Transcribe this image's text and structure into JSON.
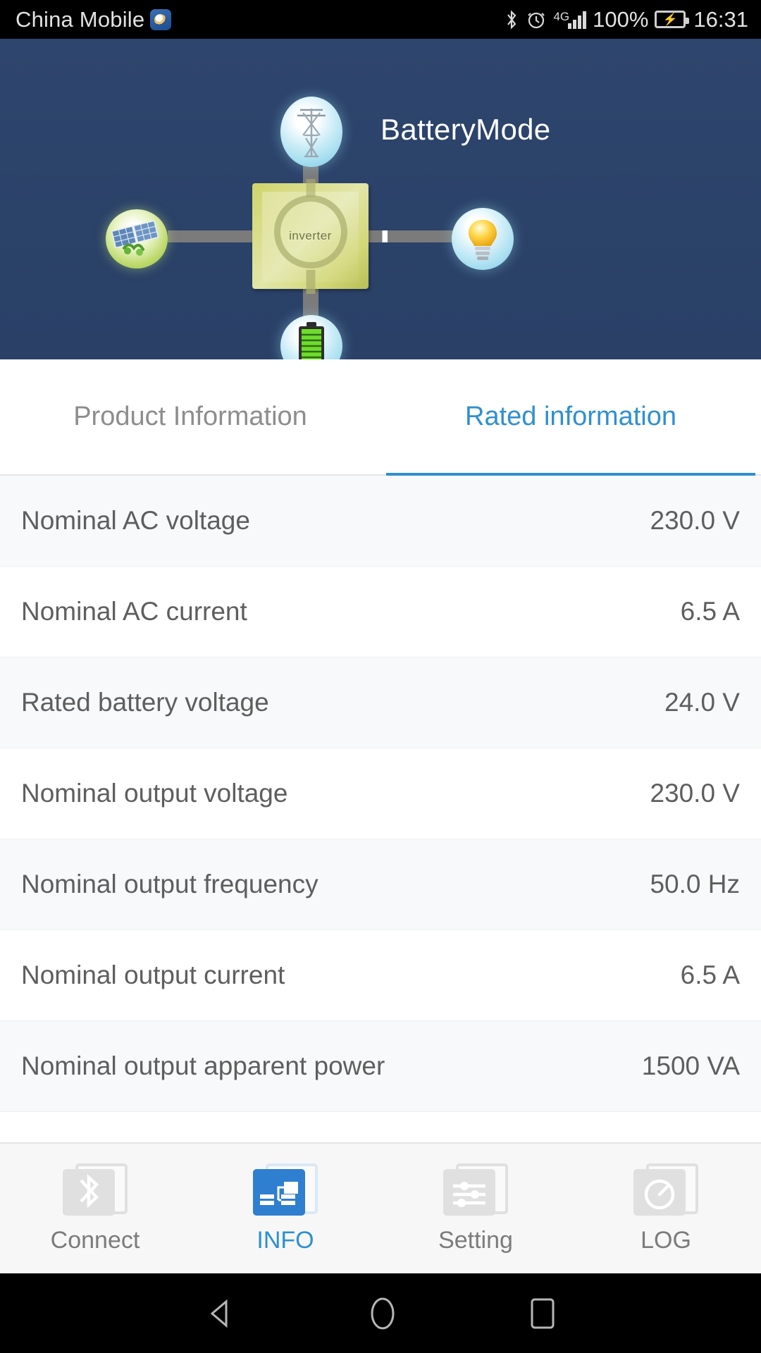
{
  "status_bar": {
    "carrier": "China Mobile",
    "app_icon": "eye-app-icon",
    "bluetooth_icon": "bluetooth-icon",
    "alarm_icon": "alarm-clock-icon",
    "network_type": "4G",
    "signal_icon": "signal-bars-icon",
    "battery_percent": "100%",
    "battery_icon": "battery-charging-icon",
    "time": "16:31"
  },
  "hero": {
    "mode_title": "BatteryMode",
    "inverter_label": "inverter",
    "nodes": {
      "grid": "power-tower-icon",
      "pv": "solar-panel-icon",
      "load": "light-bulb-icon",
      "battery": "battery-full-icon"
    },
    "background_color": "#2b4269"
  },
  "tabs": [
    {
      "label": "Product Information",
      "active": false
    },
    {
      "label": "Rated information",
      "active": true
    }
  ],
  "accent_color": "#2f90d0",
  "rows": [
    {
      "key": "Nominal AC voltage",
      "value": "230.0 V"
    },
    {
      "key": "Nominal AC current",
      "value": "6.5 A"
    },
    {
      "key": "Rated battery voltage",
      "value": "24.0 V"
    },
    {
      "key": "Nominal output voltage",
      "value": "230.0 V"
    },
    {
      "key": "Nominal output frequency",
      "value": "50.0 Hz"
    },
    {
      "key": "Nominal output current",
      "value": "6.5 A"
    },
    {
      "key": "Nominal output apparent power",
      "value": "1500 VA"
    }
  ],
  "bottom_nav": [
    {
      "label": "Connect",
      "icon": "bluetooth-icon",
      "active": false
    },
    {
      "label": "INFO",
      "icon": "info-folder-icon",
      "active": true
    },
    {
      "label": "Setting",
      "icon": "sliders-icon",
      "active": false
    },
    {
      "label": "LOG",
      "icon": "power-gauge-icon",
      "active": false
    }
  ],
  "android_nav": {
    "back": "back-triangle-icon",
    "home": "home-circle-icon",
    "recents": "recents-square-icon"
  }
}
